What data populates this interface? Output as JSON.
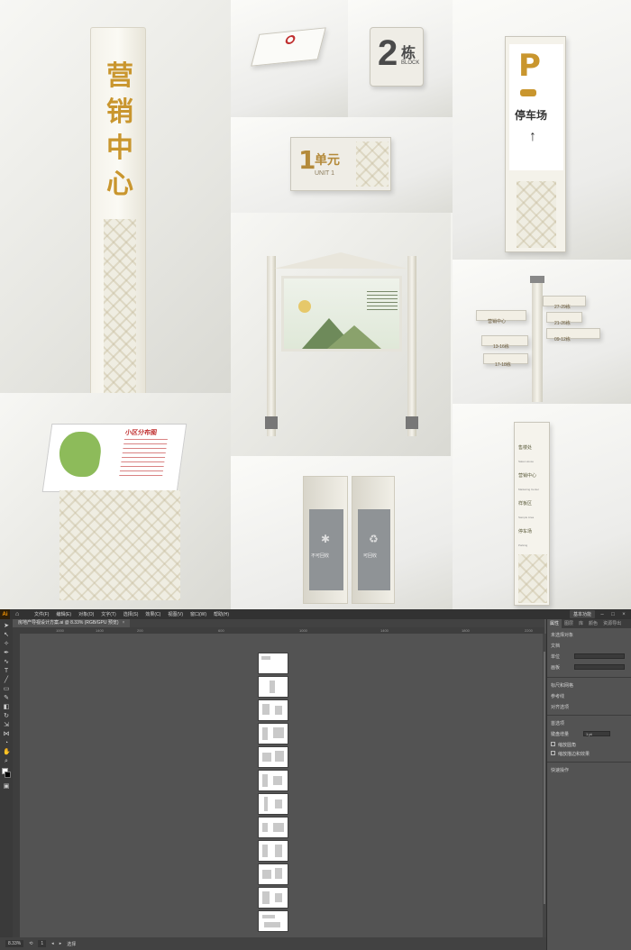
{
  "collage": {
    "tower": {
      "chars": [
        "营",
        "销",
        "中",
        "心"
      ],
      "arrow": "→"
    },
    "block_sign": {
      "number": "2",
      "label": "栋",
      "en": "BLOCK"
    },
    "unit_sign": {
      "number": "1",
      "label": "单元",
      "en": "UNIT 1"
    },
    "parking_sign": {
      "letter": "P",
      "label": "停车场",
      "arrow": "↑"
    },
    "directional_arms": [
      "27-29栋",
      "营销中心",
      "21-26栋",
      "13-16栋",
      "09-12栋",
      "17-18栋"
    ],
    "map_board": {
      "title": "小区分布图"
    },
    "bins": {
      "left_label": "不可回收",
      "right_label": "可回收"
    },
    "wayfinding_column": {
      "items": [
        "售楼处",
        "营销中心",
        "样板区",
        "停车场"
      ],
      "sub": [
        "Sales House",
        "Marketing Center",
        "Sample Area",
        "Parking"
      ]
    }
  },
  "app": {
    "logo": "Ai",
    "menu": [
      "文件(F)",
      "编辑(E)",
      "对象(O)",
      "文字(T)",
      "选择(S)",
      "效果(C)",
      "视图(V)",
      "窗口(W)",
      "帮助(H)"
    ],
    "workspace": "基本功能",
    "document_tab": "房地产导视设计方案.ai @ 8.33% (RGB/GPU 预览)",
    "ruler_marks": [
      "1000",
      "1400",
      "200",
      "600",
      "1000",
      "1400",
      "1800",
      "2200"
    ],
    "status": {
      "zoom": "8.33%",
      "page": "1",
      "tool": "选择"
    },
    "panel_tabs": [
      "属性",
      "图层",
      "库",
      "颜色",
      "资源导出"
    ],
    "panel_sections": {
      "no_selection": "未选择对象",
      "document": "文档",
      "units": "单位",
      "artboard": "画板",
      "rulers": "标尺和网格",
      "guides": "参考线",
      "snap": "对齐选项",
      "preferences": "首选项",
      "keyboard_increment": "键盘增量",
      "increment_value": "1 pt",
      "scale_corners": "缩放圆角",
      "scale_strokes": "缩放描边和效果",
      "quick_actions": "快速操作"
    },
    "artboard_count": 14
  }
}
